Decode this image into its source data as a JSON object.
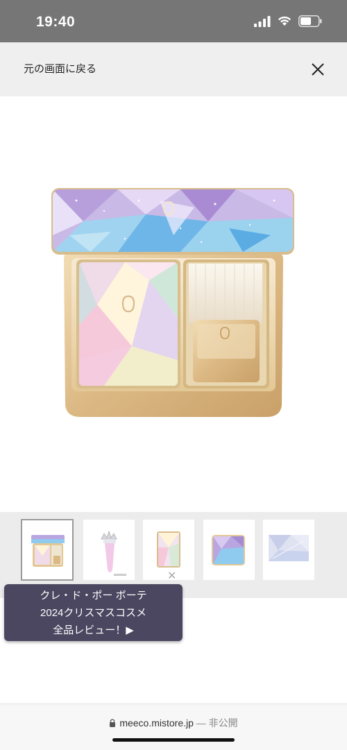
{
  "status": {
    "time": "19:40"
  },
  "header": {
    "back_label": "元の画面に戻る"
  },
  "thumbnails": [
    {
      "name": "compact"
    },
    {
      "name": "tiara-brush"
    },
    {
      "name": "powder"
    },
    {
      "name": "lid"
    },
    {
      "name": "case-texture"
    }
  ],
  "promo": {
    "line1": "クレ・ド・ポー ボーテ",
    "line2": "2024クリスマスコスメ",
    "line3": "全品レビュー！▶"
  },
  "footer": {
    "domain": "meeco.mistore.jp",
    "suffix": " — 非公開"
  },
  "colors": {
    "status_bar": "#767676",
    "promo_bg": "#4b4760",
    "gold": "#e6c795"
  }
}
